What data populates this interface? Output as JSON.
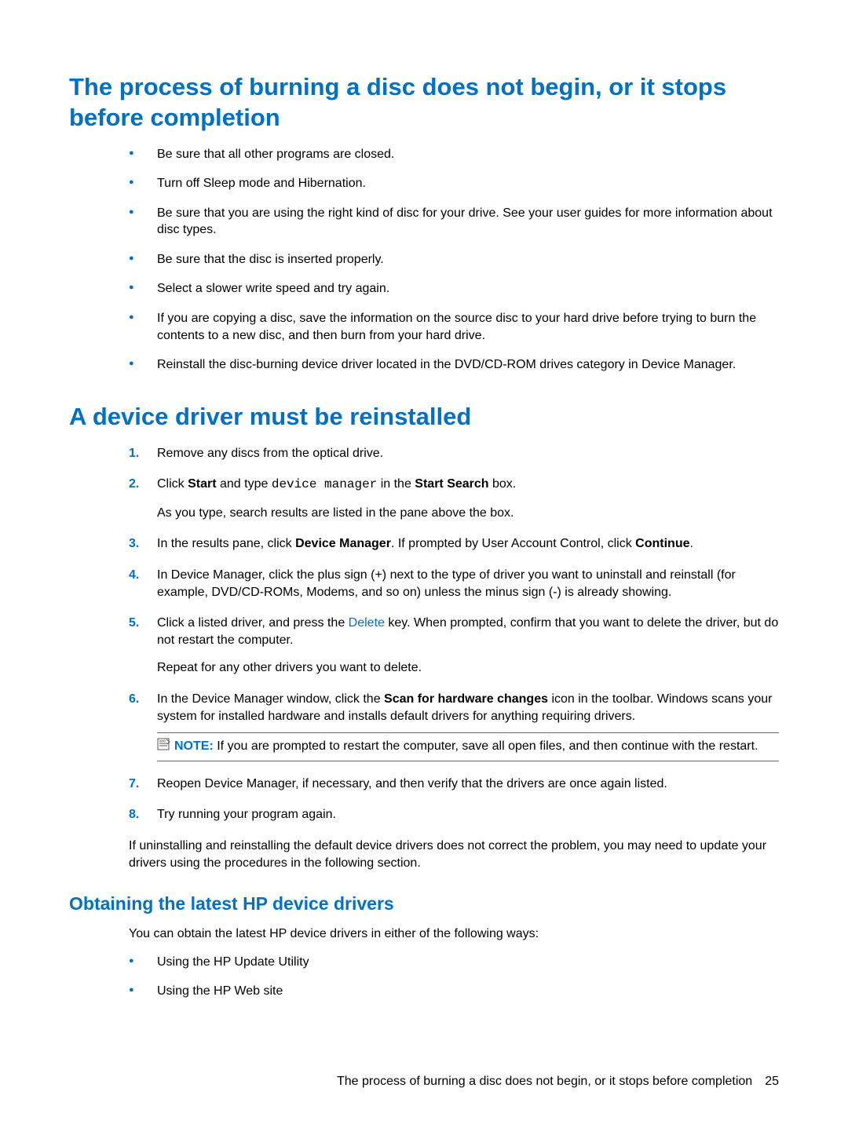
{
  "section1": {
    "title": "The process of burning a disc does not begin, or it stops before completion",
    "bullets": [
      "Be sure that all other programs are closed.",
      "Turn off Sleep mode and Hibernation.",
      "Be sure that you are using the right kind of disc for your drive. See your user guides for more information about disc types.",
      "Be sure that the disc is inserted properly.",
      "Select a slower write speed and try again.",
      "If you are copying a disc, save the information on the source disc to your hard drive before trying to burn the contents to a new disc, and then burn from your hard drive.",
      "Reinstall the disc-burning device driver located in the DVD/CD-ROM drives category in Device Manager."
    ]
  },
  "section2": {
    "title": "A device driver must be reinstalled",
    "steps": {
      "s1": "Remove any discs from the optical drive.",
      "s2_pre": "Click ",
      "s2_bold1": "Start",
      "s2_mid1": " and type ",
      "s2_mono": "device manager",
      "s2_mid2": " in the ",
      "s2_bold2": "Start Search",
      "s2_post": " box.",
      "s2_sub": "As you type, search results are listed in the pane above the box.",
      "s3_pre": "In the results pane, click ",
      "s3_bold1": "Device Manager",
      "s3_mid": ". If prompted by User Account Control, click ",
      "s3_bold2": "Continue",
      "s3_post": ".",
      "s4": "In Device Manager, click the plus sign (+) next to the type of driver you want to uninstall and reinstall (for example, DVD/CD-ROMs, Modems, and so on) unless the minus sign (-) is already showing.",
      "s5_pre": "Click a listed driver, and press the ",
      "s5_link": "Delete",
      "s5_post": " key. When prompted, confirm that you want to delete the driver, but do not restart the computer.",
      "s5_sub": "Repeat for any other drivers you want to delete.",
      "s6_pre": "In the Device Manager window, click the ",
      "s6_bold": "Scan for hardware changes",
      "s6_post": " icon in the toolbar. Windows scans your system for installed hardware and installs default drivers for anything requiring drivers.",
      "note_label": "NOTE:",
      "note_text": "If you are prompted to restart the computer, save all open files, and then continue with the restart.",
      "s7": "Reopen Device Manager, if necessary, and then verify that the drivers are once again listed.",
      "s8": "Try running your program again."
    },
    "closing": "If uninstalling and reinstalling the default device drivers does not correct the problem, you may need to update your drivers using the procedures in the following section."
  },
  "section3": {
    "title": "Obtaining the latest HP device drivers",
    "intro": "You can obtain the latest HP device drivers in either of the following ways:",
    "bullets": [
      "Using the HP Update Utility",
      "Using the HP Web site"
    ]
  },
  "footer": {
    "text": "The process of burning a disc does not begin, or it stops before completion",
    "page": "25"
  }
}
